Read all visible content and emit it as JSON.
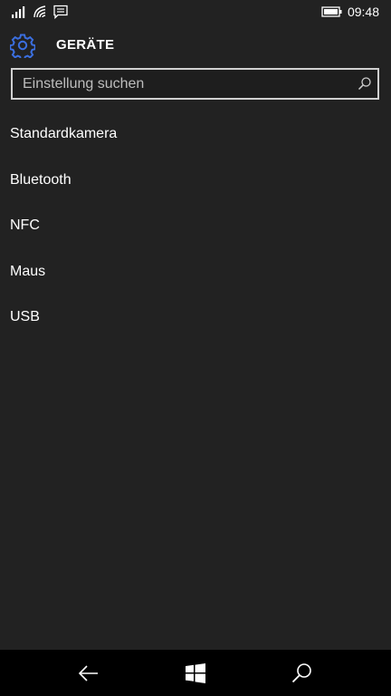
{
  "status_bar": {
    "time": "09:48",
    "icons": [
      "signal-icon",
      "wifi-icon",
      "message-icon",
      "battery-icon"
    ]
  },
  "header": {
    "title": "GERÄTE",
    "icon": "gear-icon",
    "accent_color": "#3b6fe0"
  },
  "search": {
    "placeholder": "Einstellung suchen",
    "value": ""
  },
  "list": {
    "items": [
      {
        "label": "Standardkamera"
      },
      {
        "label": "Bluetooth"
      },
      {
        "label": "NFC"
      },
      {
        "label": "Maus"
      },
      {
        "label": "USB"
      }
    ]
  },
  "nav_bar": {
    "buttons": [
      "back-icon",
      "windows-start-icon",
      "search-icon"
    ]
  }
}
